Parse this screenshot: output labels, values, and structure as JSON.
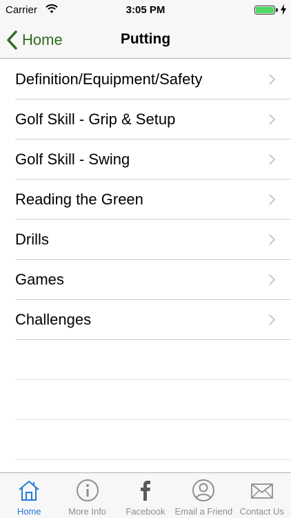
{
  "status_bar": {
    "carrier": "Carrier",
    "time": "3:05 PM"
  },
  "nav": {
    "back_label": "Home",
    "title": "Putting"
  },
  "list": {
    "items": [
      {
        "label": "Definition/Equipment/Safety"
      },
      {
        "label": "Golf Skill - Grip & Setup"
      },
      {
        "label": "Golf Skill - Swing"
      },
      {
        "label": "Reading the Green"
      },
      {
        "label": "Drills"
      },
      {
        "label": "Games"
      },
      {
        "label": "Challenges"
      }
    ]
  },
  "tab_bar": {
    "tabs": [
      {
        "label": "Home",
        "icon": "home-icon",
        "active": true
      },
      {
        "label": "More Info",
        "icon": "info-icon",
        "active": false
      },
      {
        "label": "Facebook",
        "icon": "facebook-icon",
        "active": false
      },
      {
        "label": "Email a Friend",
        "icon": "user-icon",
        "active": false
      },
      {
        "label": "Contact Us",
        "icon": "envelope-icon",
        "active": false
      }
    ]
  },
  "colors": {
    "accent": "#2e6a1f",
    "tab_active": "#1f7ad8",
    "tab_inactive": "#8e8e8e",
    "battery": "#4cd964"
  }
}
